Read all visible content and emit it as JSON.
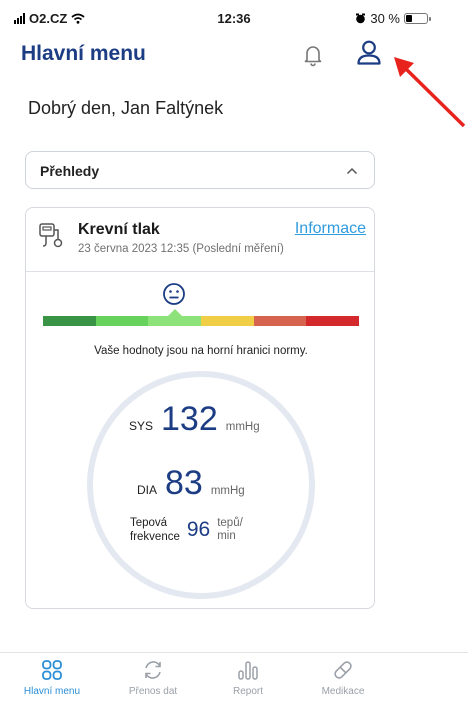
{
  "status_bar": {
    "carrier": "O2.CZ",
    "time": "12:36",
    "battery": "30 %",
    "battery_level": 0.3
  },
  "header": {
    "title": "Hlavní menu"
  },
  "greeting": "Dobrý den, Jan Faltýnek",
  "overview": {
    "label": "Přehledy"
  },
  "card": {
    "title": "Krevní tlak",
    "subtitle": "23 června 2023 12:35 (Poslední měření)",
    "info_link": "Informace",
    "scale_colors": [
      "#3a9445",
      "#67d35d",
      "#8de27a",
      "#f0cf46",
      "#d6634d",
      "#d3282c"
    ],
    "active_segment": 2,
    "message": "Vaše hodnoty jsou na horní hranici normy.",
    "sys": {
      "label": "SYS",
      "value": "132",
      "unit": "mmHg"
    },
    "dia": {
      "label": "DIA",
      "value": "83",
      "unit": "mmHg"
    },
    "pulse": {
      "label_line1": "Tepová",
      "label_line2": "frekvence",
      "value": "96",
      "unit_line1": "tepů/",
      "unit_line2": "min"
    }
  },
  "nav": {
    "items": [
      {
        "label": "Hlavní menu",
        "icon": "home-grid-icon",
        "active": true
      },
      {
        "label": "Přenos dat",
        "icon": "sync-icon",
        "active": false
      },
      {
        "label": "Report",
        "icon": "report-bars-icon",
        "active": false
      },
      {
        "label": "Medikace",
        "icon": "pill-icon",
        "active": false
      }
    ]
  },
  "colors": {
    "brand": "#1c3c84",
    "link": "#2f9be0",
    "active_nav": "#2b8ed6",
    "arrow": "#e8231e"
  }
}
